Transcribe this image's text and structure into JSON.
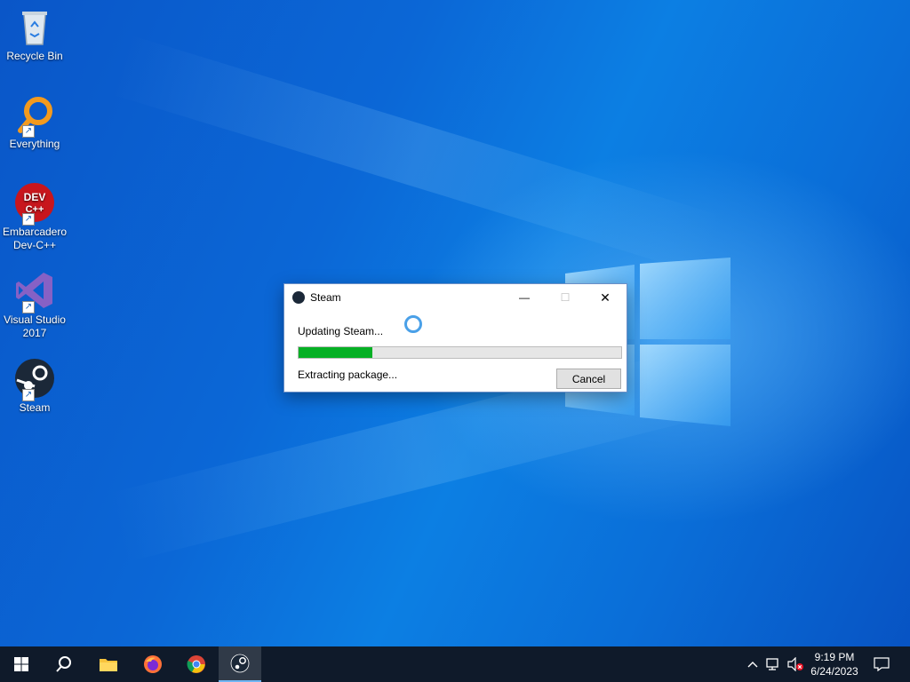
{
  "desktop": {
    "icons": [
      {
        "label": "Recycle Bin",
        "icon": "recycle-bin-icon"
      },
      {
        "label": "Everything",
        "icon": "everything-search-icon"
      },
      {
        "label": "Embarcadero Dev-C++",
        "icon": "devcpp-icon",
        "badge": "DEV C++"
      },
      {
        "label": "Visual Studio 2017",
        "icon": "visual-studio-icon"
      },
      {
        "label": "Steam",
        "icon": "steam-icon"
      }
    ]
  },
  "dialog": {
    "title": "Steam",
    "status": "Updating Steam...",
    "substatus": "Extracting package...",
    "progress_fraction": 0.23,
    "cancel_label": "Cancel",
    "minimize_glyph": "—",
    "maximize_glyph": "☐",
    "close_glyph": "✕"
  },
  "taskbar": {
    "apps": [
      "start-icon",
      "search-icon",
      "file-explorer-icon",
      "firefox-icon",
      "chrome-icon",
      "steam-icon"
    ],
    "active_app": "steam",
    "tray": {
      "chevron": "^",
      "time": "9:19 PM",
      "date": "6/24/2023"
    }
  },
  "colors": {
    "progress_green": "#06b025",
    "taskbar_bg": "#0f1a2a",
    "desktop_blue": "#0b67d6"
  }
}
